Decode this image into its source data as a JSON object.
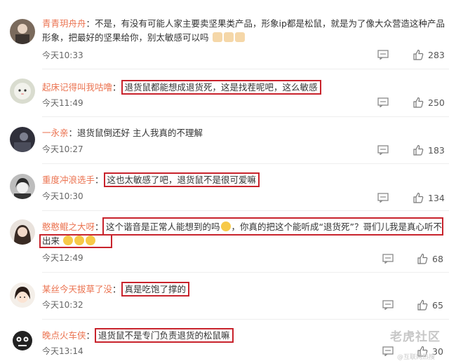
{
  "comments": [
    {
      "user": "青青玥舟舟",
      "sep": "：",
      "line1": "不是，有没有可能人家主要卖坚果类产品，形象ip都是松鼠，就是为了像大众营造这种产品",
      "line2": "形象，把最好的坚果给你，别太敏感可以吗",
      "time": "今天10:33",
      "likes": "283"
    },
    {
      "user": "起床记得叫我咕噜",
      "sep": "：",
      "text": "退货鼠都能想成退货死，这是找茬呢吧，这么敏感",
      "time": "今天11:49",
      "likes": "250"
    },
    {
      "user": "一永亲",
      "sep": "：",
      "text": "退货鼠倒还好 主人我真的不理解",
      "time": "今天10:27",
      "likes": "183"
    },
    {
      "user": "重度冲浪选手",
      "sep": "：",
      "text": "这也太敏感了吧，退货鼠不是很可爱嘛",
      "time": "今天10:30",
      "likes": "134"
    },
    {
      "user": "憨憨鲲之大呀",
      "sep": "：",
      "line1a": "这个谐音是正常人能想到的吗",
      "line1b": "，你真的把这个能听成“退货死”？哥们儿我是真心听不",
      "line2": "出来",
      "time": "今天12:49",
      "likes": "68"
    },
    {
      "user": "某丝今天拔草了没",
      "sep": "：",
      "text": "真是吃饱了撑的",
      "time": "今天10:32",
      "likes": "65"
    },
    {
      "user": "晚点火车侠",
      "sep": "：",
      "text": "退货鼠不是专门负责退货的松鼠嘛",
      "time": "今天13:14",
      "likes": "30"
    }
  ],
  "watermark": {
    "main": "老虎社区",
    "sub": "@互联网热搜"
  },
  "colors": {
    "username": "#eb7350",
    "highlight": "#c8232c"
  },
  "icons": {
    "comment": "comment-icon",
    "like": "thumbs-up-icon"
  }
}
